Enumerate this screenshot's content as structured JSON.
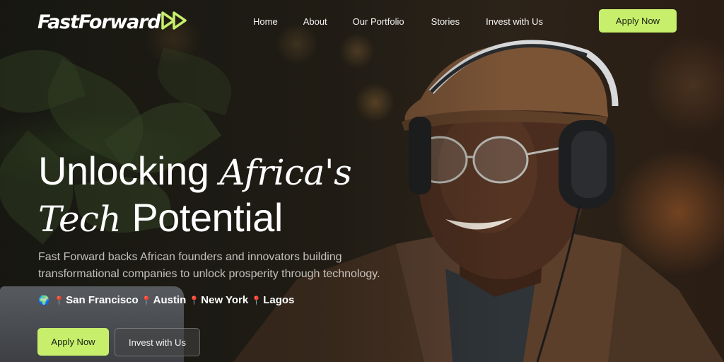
{
  "nav": {
    "logo_text": "FastForward",
    "links": [
      "Home",
      "About",
      "Our Portfolio",
      "Stories",
      "Invest with Us"
    ],
    "cta_label": "Apply Now"
  },
  "hero": {
    "headline_word1": "Unlocking ",
    "headline_word2": "Africa's",
    "headline_word3": "Tech",
    "headline_word4": " Potential",
    "subtitle": "Fast Forward backs African founders and innovators building transformational companies to unlock prosperity through technology.",
    "locations": [
      "San Francisco",
      "Austin",
      "New York",
      "Lagos"
    ],
    "primary_button": "Apply Now",
    "secondary_button": "Invest with Us"
  },
  "colors": {
    "accent": "#c7ef6c",
    "pin": "#e74c3c"
  },
  "icons": {
    "logo_mark": "fast-forward-icon",
    "globe": "globe-icon",
    "pin": "location-pin-icon"
  }
}
